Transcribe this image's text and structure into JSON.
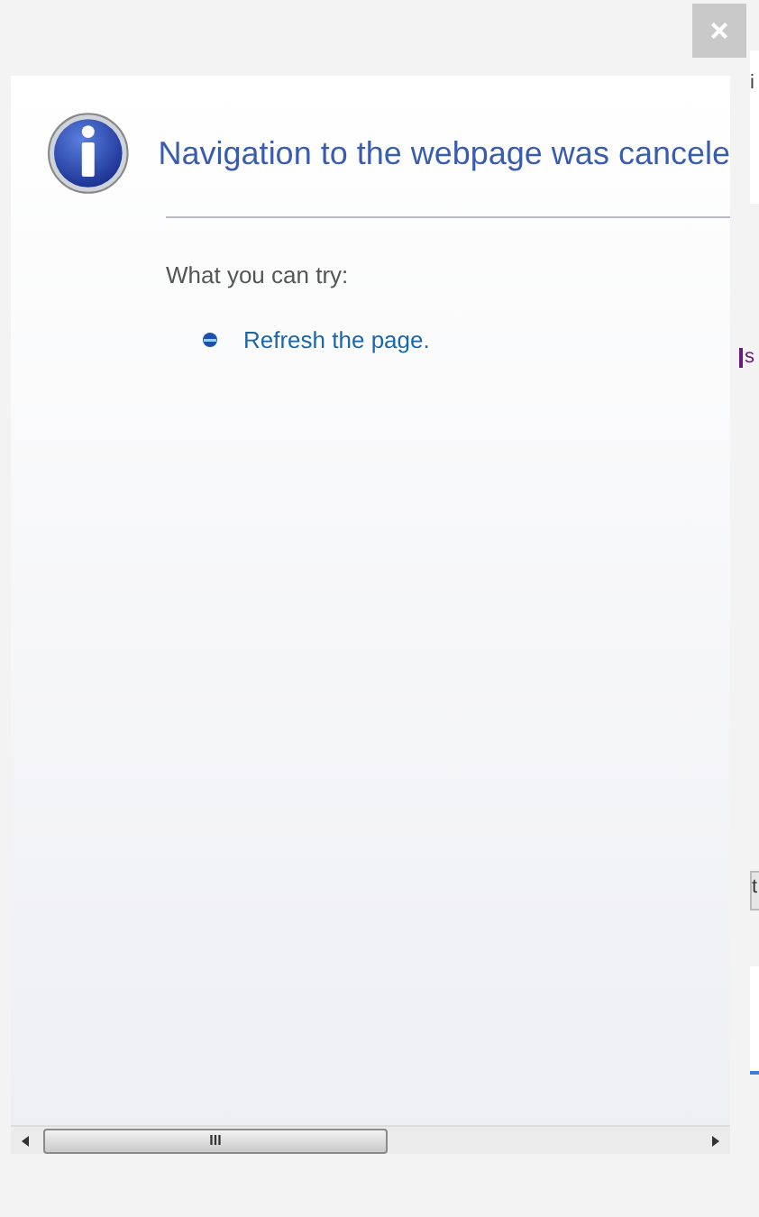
{
  "close_button": {
    "label": "×"
  },
  "page": {
    "title": "Navigation to the webpage was cancele",
    "section_label": "What you can try:",
    "suggestions": [
      {
        "text": "Refresh the page."
      }
    ]
  },
  "scrollbar": {
    "thumb_label": "III"
  },
  "background_fragments": [
    "i",
    "s",
    "t"
  ]
}
